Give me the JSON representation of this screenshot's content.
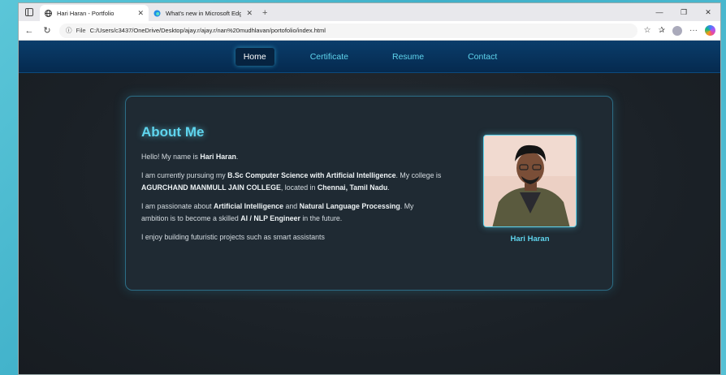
{
  "browser": {
    "tabs": [
      {
        "title": "Hari Haran - Portfolio",
        "active": true
      },
      {
        "title": "What's new in Microsoft Edge",
        "active": false
      }
    ],
    "address": {
      "scheme": "File",
      "url": "C:/Users/c3437/OneDrive/Desktop/ajay.r/ajay.r/nan%20mudhlavan/portofolio/index.html"
    }
  },
  "site": {
    "nav": [
      "Home",
      "Certificate",
      "Resume",
      "Contact"
    ],
    "about": {
      "heading": "About Me",
      "p1_pre": "Hello! My name is ",
      "p1_name": "Hari Haran",
      "p1_post": ".",
      "p2_a": "I am currently pursuing my ",
      "p2_degree": "B.Sc Computer Science with Artificial Intelligence",
      "p2_b": ". My college is ",
      "p2_college": "AGURCHAND MANMULL JAIN COLLEGE",
      "p2_c": ", located in ",
      "p2_city": "Chennai, Tamil Nadu",
      "p2_d": ".",
      "p3_a": "I am passionate about ",
      "p3_ai": "Artificial Intelligence",
      "p3_b": " and ",
      "p3_nlp": "Natural Language Processing",
      "p3_c": ". My ambition is to become a skilled ",
      "p3_role": "AI / NLP Engineer",
      "p3_d": " in the future.",
      "p4": "I enjoy building futuristic projects such as smart assistants"
    },
    "profile_caption": "Hari Haran"
  },
  "colors": {
    "accent": "#5fd5ee",
    "nav_bg": "#052a4f",
    "page_bg": "#1b2127"
  }
}
